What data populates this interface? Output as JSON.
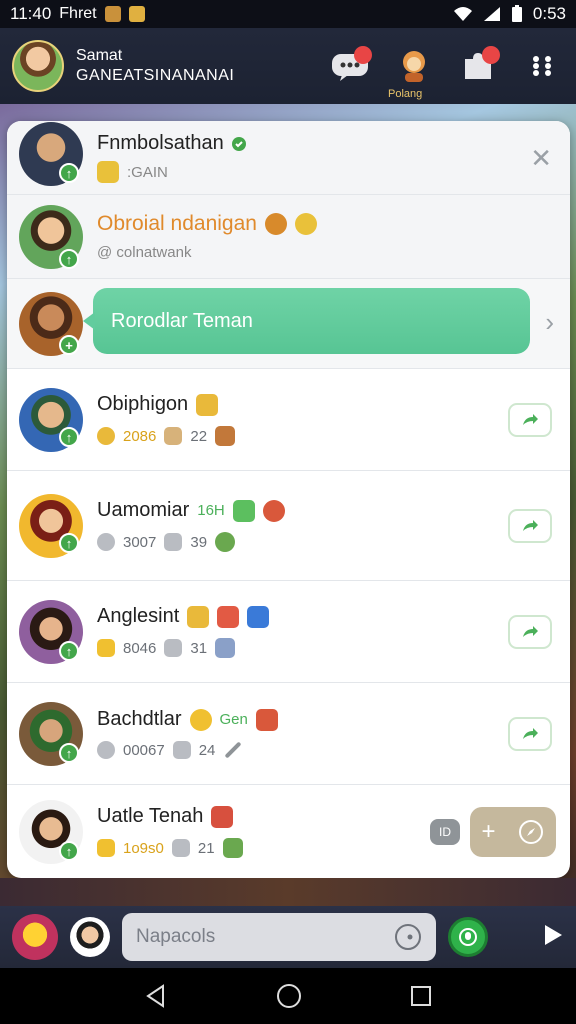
{
  "status_bar": {
    "time": "11:40",
    "carrier": "Fhret",
    "battery_time": "0:53"
  },
  "header": {
    "user_name": "Samat",
    "user_subtitle": "GANEATSINANANAI",
    "chat_badge": "",
    "notify_badge": "",
    "profile_caption": "Polang"
  },
  "friends": [
    {
      "name": "Fnmbolsathan",
      "meta": ":GAIN",
      "verified": true
    },
    {
      "name": "Obroial ndanigan",
      "meta": "@ colnatwank",
      "highlight_color": "#e08a2c"
    },
    {
      "name": "",
      "action": "Rorodlar Teman"
    },
    {
      "name": "Obiphigon",
      "coins": "2086",
      "level": "22"
    },
    {
      "name": "Uamomiar",
      "tag": "16H",
      "coins": "3007",
      "level": "39"
    },
    {
      "name": "Anglesint",
      "coins": "8046",
      "level": "31"
    },
    {
      "name": "Bachdtlar",
      "tag": "Gen",
      "coins": "00067",
      "level": "24"
    },
    {
      "name": "Uatle Tenah",
      "coins": "1o9s0",
      "level": "21",
      "toggle": "ID"
    }
  ],
  "chat": {
    "placeholder": "Napacols"
  },
  "colors": {
    "accent_green": "#57c594",
    "online": "#43a64a",
    "coin": "#d9a21b"
  }
}
